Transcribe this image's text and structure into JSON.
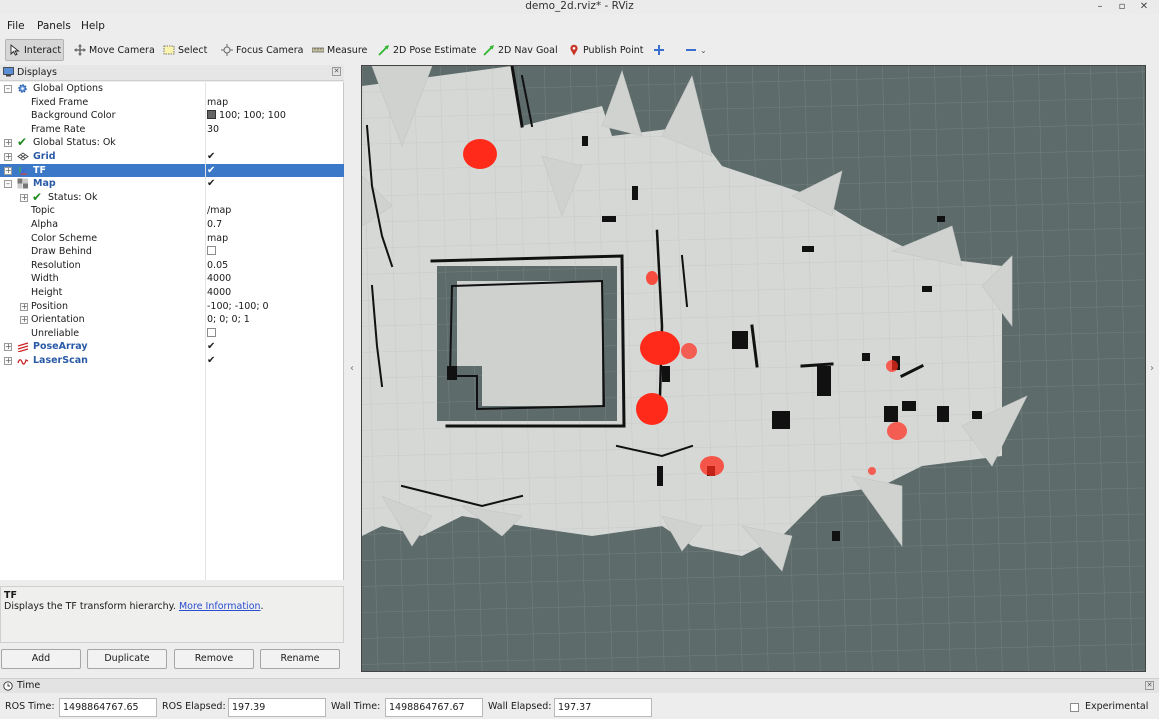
{
  "window": {
    "title": "demo_2d.rviz* - RViz"
  },
  "menu": [
    "File",
    "Panels",
    "Help"
  ],
  "toolbar": {
    "tools": [
      {
        "label": "Interact",
        "icon": "cursor-icon",
        "active": true
      },
      {
        "label": "Move Camera",
        "icon": "move-camera-icon"
      },
      {
        "label": "Select",
        "icon": "select-icon"
      },
      {
        "label": "Focus Camera",
        "icon": "focus-camera-icon"
      },
      {
        "label": "Measure",
        "icon": "ruler-icon"
      },
      {
        "label": "2D Pose Estimate",
        "icon": "pose-estimate-arrow-icon"
      },
      {
        "label": "2D Nav Goal",
        "icon": "nav-goal-arrow-icon"
      },
      {
        "label": "Publish Point",
        "icon": "map-pin-icon"
      }
    ]
  },
  "displays": {
    "header": "Displays",
    "rows": [
      {
        "name": "Global Options",
        "value": ""
      },
      {
        "name": "Fixed Frame",
        "value": "map"
      },
      {
        "name": "Background Color",
        "value": "100; 100; 100"
      },
      {
        "name": "Frame Rate",
        "value": "30"
      },
      {
        "name": "Global Status: Ok",
        "value": ""
      },
      {
        "name": "Grid",
        "value": ""
      },
      {
        "name": "TF",
        "value": ""
      },
      {
        "name": "Map",
        "value": ""
      },
      {
        "name": "Status: Ok",
        "value": ""
      },
      {
        "name": "Topic",
        "value": "/map"
      },
      {
        "name": "Alpha",
        "value": "0.7"
      },
      {
        "name": "Color Scheme",
        "value": "map"
      },
      {
        "name": "Draw Behind",
        "value": ""
      },
      {
        "name": "Resolution",
        "value": "0.05"
      },
      {
        "name": "Width",
        "value": "4000"
      },
      {
        "name": "Height",
        "value": "4000"
      },
      {
        "name": "Position",
        "value": "-100; -100; 0"
      },
      {
        "name": "Orientation",
        "value": "0; 0; 0; 1"
      },
      {
        "name": "Unreliable",
        "value": ""
      },
      {
        "name": "PoseArray",
        "value": ""
      },
      {
        "name": "LaserScan",
        "value": ""
      }
    ]
  },
  "description": {
    "title": "TF",
    "text": "Displays the TF transform hierarchy.",
    "link": "More Information"
  },
  "buttons": [
    "Add",
    "Duplicate",
    "Remove",
    "Rename"
  ],
  "time": {
    "header": "Time",
    "ros_time_label": "ROS Time:",
    "ros_time": "1498864767.65",
    "ros_elapsed_label": "ROS Elapsed:",
    "ros_elapsed": "197.39",
    "wall_time_label": "Wall Time:",
    "wall_time": "1498864767.67",
    "wall_elapsed_label": "Wall Elapsed:",
    "wall_elapsed": "197.37",
    "experimental_label": "Experimental"
  },
  "colors": {
    "viewport_bg": "#5d6b6b",
    "free_space": "#d4d6d4",
    "obstacle": "#111111",
    "particles": "#ff2a1a",
    "selection": "#3b79c8"
  }
}
